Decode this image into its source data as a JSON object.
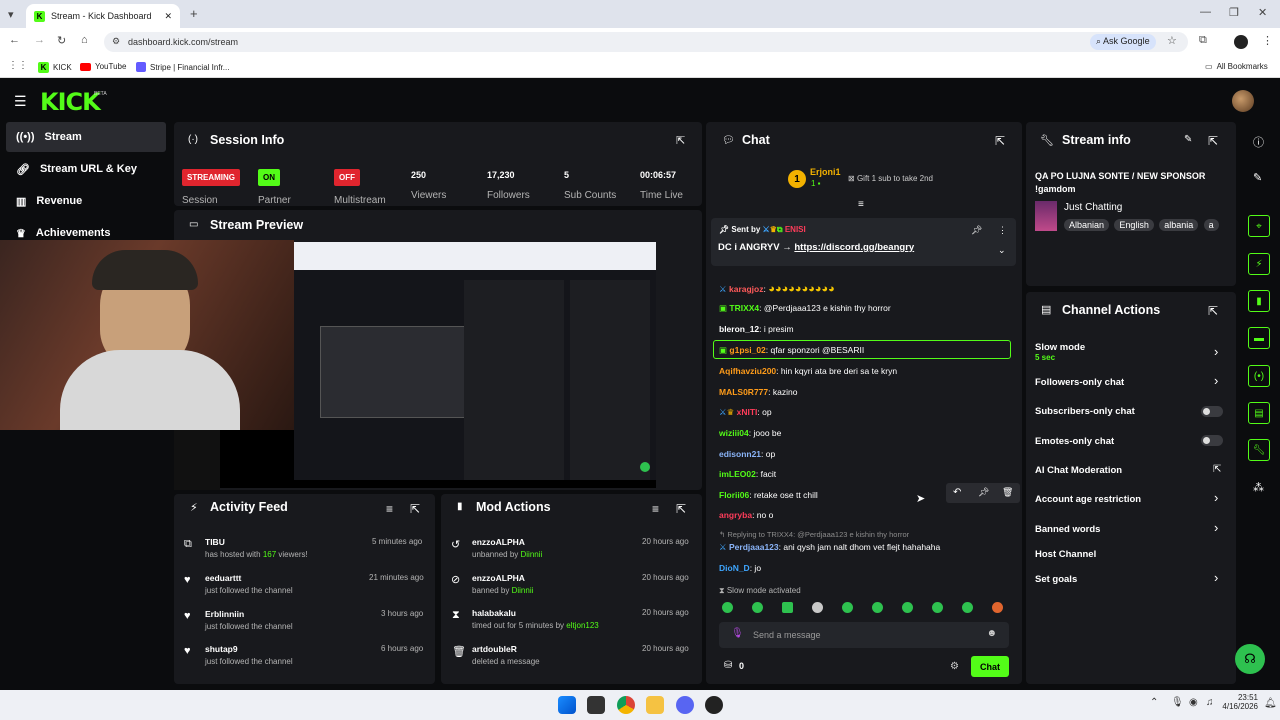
{
  "browser": {
    "tab_title": "Stream - Kick Dashboard",
    "url": "dashboard.kick.com/stream",
    "ask_google": "Ask Google",
    "bookmarks": [
      "KICK",
      "YouTube",
      "Stripe | Financial Infr..."
    ],
    "all_bookmarks": "All Bookmarks"
  },
  "brand": {
    "logo": "KICK",
    "beta": "BETA",
    "accent": "#53fc18"
  },
  "sidebar": {
    "items": [
      {
        "label": "Stream",
        "icon": "broadcast-icon"
      },
      {
        "label": "Stream URL & Key",
        "icon": "link-icon"
      },
      {
        "label": "Revenue",
        "icon": "chart-icon"
      },
      {
        "label": "Achievements",
        "icon": "trophy-icon"
      }
    ]
  },
  "session": {
    "title": "Session Info",
    "stats": [
      {
        "value": "STREAMING",
        "label": "Session"
      },
      {
        "value": "ON",
        "label": "Partner"
      },
      {
        "value": "OFF",
        "label": "Multistream"
      },
      {
        "value": "250",
        "label": "Viewers"
      },
      {
        "value": "17,230",
        "label": "Followers"
      },
      {
        "value": "5",
        "label": "Sub Counts"
      },
      {
        "value": "00:06:57",
        "label": "Time Live"
      }
    ]
  },
  "preview": {
    "title": "Stream Preview"
  },
  "activity": {
    "title": "Activity Feed",
    "items": [
      {
        "name": "TIBU",
        "desc_pre": "has hosted with ",
        "desc_num": "167",
        "desc_post": " viewers!",
        "time": "5 minutes ago"
      },
      {
        "name": "eeduarttt",
        "desc": "just followed the channel",
        "time": "21 minutes ago"
      },
      {
        "name": "Erblinniin",
        "desc": "just followed the channel",
        "time": "3 hours ago"
      },
      {
        "name": "shutap9",
        "desc": "just followed the channel",
        "time": "6 hours ago"
      }
    ]
  },
  "mod": {
    "title": "Mod Actions",
    "items": [
      {
        "name": "enzzoALPHA",
        "desc": "unbanned by ",
        "by": "Diinnii",
        "time": "20 hours ago"
      },
      {
        "name": "enzzoALPHA",
        "desc": "banned by ",
        "by": "Diinnii",
        "time": "20 hours ago"
      },
      {
        "name": "halabakalu",
        "desc": "timed out for 5 minutes by ",
        "by": "eltjon123",
        "time": "20 hours ago"
      },
      {
        "name": "artdoubleR",
        "desc": "deleted a message",
        "by": "",
        "time": "20 hours ago"
      }
    ]
  },
  "chat": {
    "title": "Chat",
    "top_gifter": "Erjoni1",
    "top_rank": "1",
    "gift_text": "Gift 1 sub to take 2nd",
    "pinned_sent_by": "Sent by",
    "pinned_user": "ENISI",
    "pinned_text_pre": "DC i ANGRYV → ",
    "pinned_link": "https://discord.gg/beangry",
    "messages": [
      {
        "user": "karagjoz",
        "color": "#ff5a5a",
        "text": ""
      },
      {
        "user": "TRIXX4",
        "color": "#53fc18",
        "text": ": @Perdjaaa123 e kishin thy horror"
      },
      {
        "user": "bleron_12",
        "color": "#ffffff",
        "text": ": i presim"
      },
      {
        "user": "g1psi_02",
        "color": "#ff9c1a",
        "text": ": qfar sponzori @BESARII"
      },
      {
        "user": "Aqifhavziu200",
        "color": "#ff9c1a",
        "text": ": hin kqyri ata bre deri sa te kryn"
      },
      {
        "user": "MALS0R777",
        "color": "#ff9c1a",
        "text": ": kazino"
      },
      {
        "user": "xNITI",
        "color": "#ff3c5a",
        "text": ": op"
      },
      {
        "user": "wiziii04",
        "color": "#53fc18",
        "text": ": jooo be"
      },
      {
        "user": "edisonn21",
        "color": "#8ab4f8",
        "text": ": op"
      },
      {
        "user": "imLEO02",
        "color": "#53fc18",
        "text": ": facit"
      },
      {
        "user": "Florii06",
        "color": "#53fc18",
        "text": ": retake ose tt chill"
      },
      {
        "user": "angryba",
        "color": "#ff3c5a",
        "text": ": no o"
      },
      {
        "user": "Perdjaaa123",
        "color": "#8ab4f8",
        "text": ": ani qysh jam nalt dhom vet flejt hahahaha"
      },
      {
        "user": "DioN_D",
        "color": "#3ea6ff",
        "text": ": jo"
      }
    ],
    "reply_to": "Replying to TRIXX4: @Perdjaaa123 e kishin thy horror",
    "slow_mode": "Slow mode activated",
    "input_placeholder": "Send a message",
    "count": "0",
    "send": "Chat"
  },
  "stream_info": {
    "title": "Stream info",
    "stream_title": "QA PO LUJNA SONTE / NEW SPONSOR !gamdom",
    "category": "Just Chatting",
    "tags": [
      "Albanian",
      "English",
      "albania",
      "a"
    ]
  },
  "channel_actions": {
    "title": "Channel Actions",
    "items": [
      {
        "label": "Slow mode",
        "sub": "5 sec",
        "control": "chevron"
      },
      {
        "label": "Followers-only chat",
        "sub": "",
        "control": "chevron"
      },
      {
        "label": "Subscribers-only chat",
        "sub": "",
        "control": "toggle"
      },
      {
        "label": "Emotes-only chat",
        "sub": "",
        "control": "toggle"
      },
      {
        "label": "AI Chat Moderation",
        "sub": "",
        "control": "external"
      },
      {
        "label": "Account age restriction",
        "sub": "",
        "control": "chevron"
      },
      {
        "label": "Banned words",
        "sub": "",
        "control": "chevron"
      },
      {
        "label": "Host Channel",
        "sub": "",
        "control": "none"
      },
      {
        "label": "Set goals",
        "sub": "",
        "control": "chevron"
      }
    ]
  },
  "taskbar": {
    "time": "23:51",
    "date": "4/16/2026"
  }
}
